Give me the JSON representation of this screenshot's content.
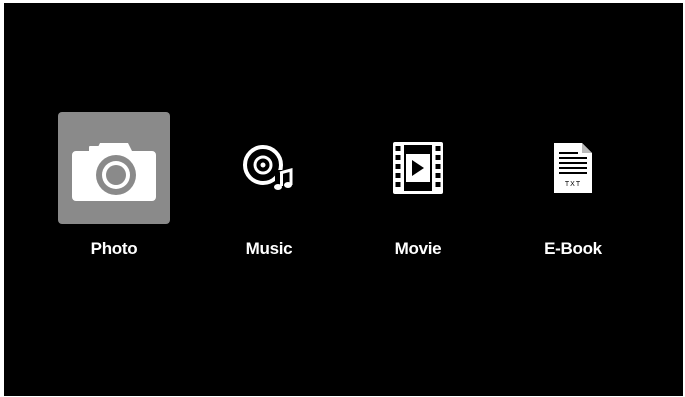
{
  "menu": {
    "items": [
      {
        "label": "Photo",
        "icon": "camera-icon",
        "selected": true
      },
      {
        "label": "Music",
        "icon": "music-disc-icon",
        "selected": false
      },
      {
        "label": "Movie",
        "icon": "film-play-icon",
        "selected": false
      },
      {
        "label": "E-Book",
        "icon": "txt-document-icon",
        "selected": false
      }
    ],
    "ebook_icon_text": "TXT"
  },
  "colors": {
    "background": "#000000",
    "selected_tile": "#8a8a8a",
    "text": "#ffffff"
  }
}
